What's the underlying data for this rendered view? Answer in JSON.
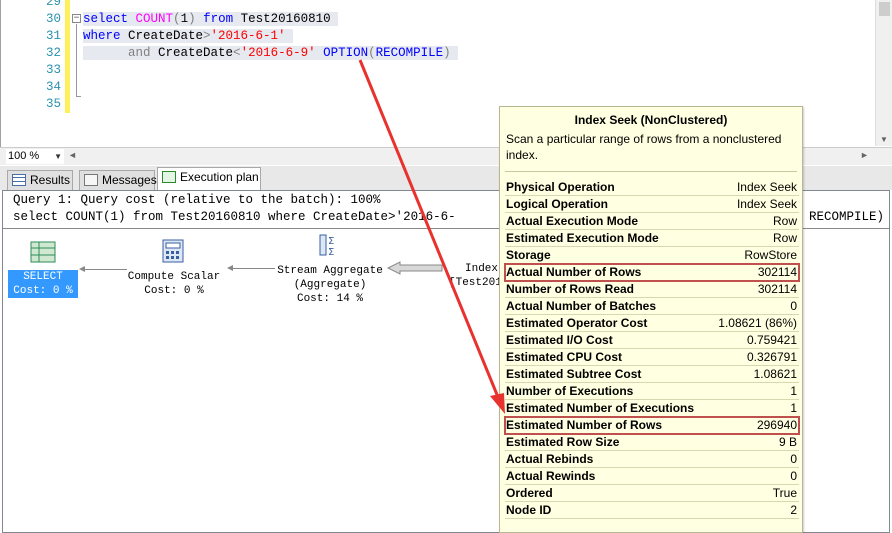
{
  "editor": {
    "line_numbers": [
      "29",
      "30",
      "31",
      "32",
      "33",
      "34",
      "35"
    ],
    "lines": [
      {
        "parts": [
          {
            "t": "select",
            "c": "kw"
          },
          {
            "t": " ",
            "c": "plain"
          },
          {
            "t": "COUNT",
            "c": "fn"
          },
          {
            "t": "(",
            "c": "op"
          },
          {
            "t": "1",
            "c": "plain"
          },
          {
            "t": ")",
            "c": "op"
          },
          {
            "t": " ",
            "c": "plain"
          },
          {
            "t": "from",
            "c": "kw"
          },
          {
            "t": " Test20160810 ",
            "c": "plain"
          }
        ]
      },
      {
        "parts": [
          {
            "t": "where",
            "c": "kw"
          },
          {
            "t": " CreateDate",
            "c": "plain"
          },
          {
            "t": ">",
            "c": "op"
          },
          {
            "t": "'2016-6-1'",
            "c": "str"
          },
          {
            "t": " ",
            "c": "plain"
          }
        ]
      },
      {
        "parts": [
          {
            "t": "      ",
            "c": "plain"
          },
          {
            "t": "and",
            "c": "op"
          },
          {
            "t": " CreateDate",
            "c": "plain"
          },
          {
            "t": "<",
            "c": "op"
          },
          {
            "t": "'2016-6-9'",
            "c": "str"
          },
          {
            "t": " ",
            "c": "plain"
          },
          {
            "t": "OPTION",
            "c": "kw"
          },
          {
            "t": "(",
            "c": "op"
          },
          {
            "t": "RECOMPILE",
            "c": "kw"
          },
          {
            "t": ")",
            "c": "op"
          },
          {
            "t": " ",
            "c": "plain"
          }
        ]
      }
    ]
  },
  "zoom": {
    "value": "100 %"
  },
  "tabs": [
    {
      "label": "Results"
    },
    {
      "label": "Messages"
    },
    {
      "label": "Execution plan"
    }
  ],
  "plan": {
    "query_line1": "Query 1: Query cost (relative to the batch): 100%",
    "query_line2": "select COUNT(1) from Test20160810 where CreateDate>'2016-6-",
    "query_line2_tail": "RECOMPILE)",
    "nodes": [
      {
        "name": "SELECT",
        "sub": "Cost: 0 %"
      },
      {
        "name": "Compute Scalar",
        "sub": "Cost: 0 %"
      },
      {
        "name": "Stream Aggregate",
        "sub": "(Aggregate)",
        "sub2": "Cost: 14 %"
      },
      {
        "name": "Index",
        "sub": "[Test201"
      }
    ]
  },
  "tooltip": {
    "title": "Index Seek (NonClustered)",
    "description": "Scan a particular range of rows from a nonclustered index.",
    "rows": [
      {
        "k": "Physical Operation",
        "v": "Index Seek"
      },
      {
        "k": "Logical Operation",
        "v": "Index Seek"
      },
      {
        "k": "Actual Execution Mode",
        "v": "Row"
      },
      {
        "k": "Estimated Execution Mode",
        "v": "Row"
      },
      {
        "k": "Storage",
        "v": "RowStore"
      },
      {
        "k": "Actual Number of Rows",
        "v": "302114",
        "highlight": true
      },
      {
        "k": "Number of Rows Read",
        "v": "302114"
      },
      {
        "k": "Actual Number of Batches",
        "v": "0"
      },
      {
        "k": "Estimated Operator Cost",
        "v": "1.08621 (86%)"
      },
      {
        "k": "Estimated I/O Cost",
        "v": "0.759421"
      },
      {
        "k": "Estimated CPU Cost",
        "v": "0.326791"
      },
      {
        "k": "Estimated Subtree Cost",
        "v": "1.08621"
      },
      {
        "k": "Number of Executions",
        "v": "1"
      },
      {
        "k": "Estimated Number of Executions",
        "v": "1"
      },
      {
        "k": "Estimated Number of Rows",
        "v": "296940",
        "highlight": true
      },
      {
        "k": "Estimated Row Size",
        "v": "9 B"
      },
      {
        "k": "Actual Rebinds",
        "v": "0"
      },
      {
        "k": "Actual Rewinds",
        "v": "0"
      },
      {
        "k": "Ordered",
        "v": "True"
      },
      {
        "k": "Node ID",
        "v": "2"
      }
    ]
  },
  "colors": {
    "keyword": "#0000ff",
    "function": "#ff00ff",
    "string": "#ff0000",
    "line_number": "#2b91af",
    "tooltip_bg": "#ffffe1",
    "highlight_border": "#c0504d",
    "annotation_arrow": "#e8322e",
    "selected_node": "#3399ff"
  }
}
